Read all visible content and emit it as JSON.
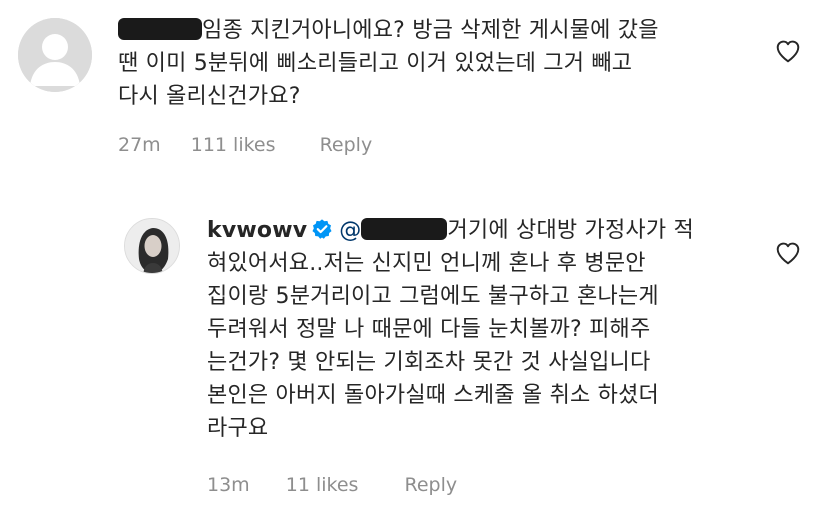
{
  "comments": [
    {
      "mention_prefix": "",
      "lines": [
        "임종 지킨거아니에요? 방금 삭제한 게시물에 갔을",
        "땐 이미 5분뒤에 삐소리들리고 이거 있었는데 그거 빼고",
        "다시 올리신건가요?"
      ],
      "time": "27m",
      "likes": "111 likes",
      "reply": "Reply"
    },
    {
      "username": "kvwowv",
      "mention_prefix": "@",
      "lines": [
        "거기에 상대방 가정사가 적",
        "혀있어서요..저는 신지민 언니께 혼나 후 병문안",
        "집이랑 5분거리이고 그럼에도 불구하고 혼나는게",
        "두려워서 정말 나 때문에 다들 눈치볼까? 피해주",
        "는건가? 몇 안되는 기회조차 못간 것 사실입니다",
        "본인은 아버지 돌아가실때 스케줄 올 취소 하셨더",
        "라구요"
      ],
      "time": "13m",
      "likes": "11 likes",
      "reply": "Reply"
    }
  ],
  "icons": {
    "heart": "heart-outline-icon",
    "verified": "verified-badge-icon",
    "avatar_default": "default-avatar-icon"
  },
  "colors": {
    "text": "#262626",
    "meta": "#8e8e8e",
    "mention": "#00376b",
    "verified": "#0095f6"
  }
}
